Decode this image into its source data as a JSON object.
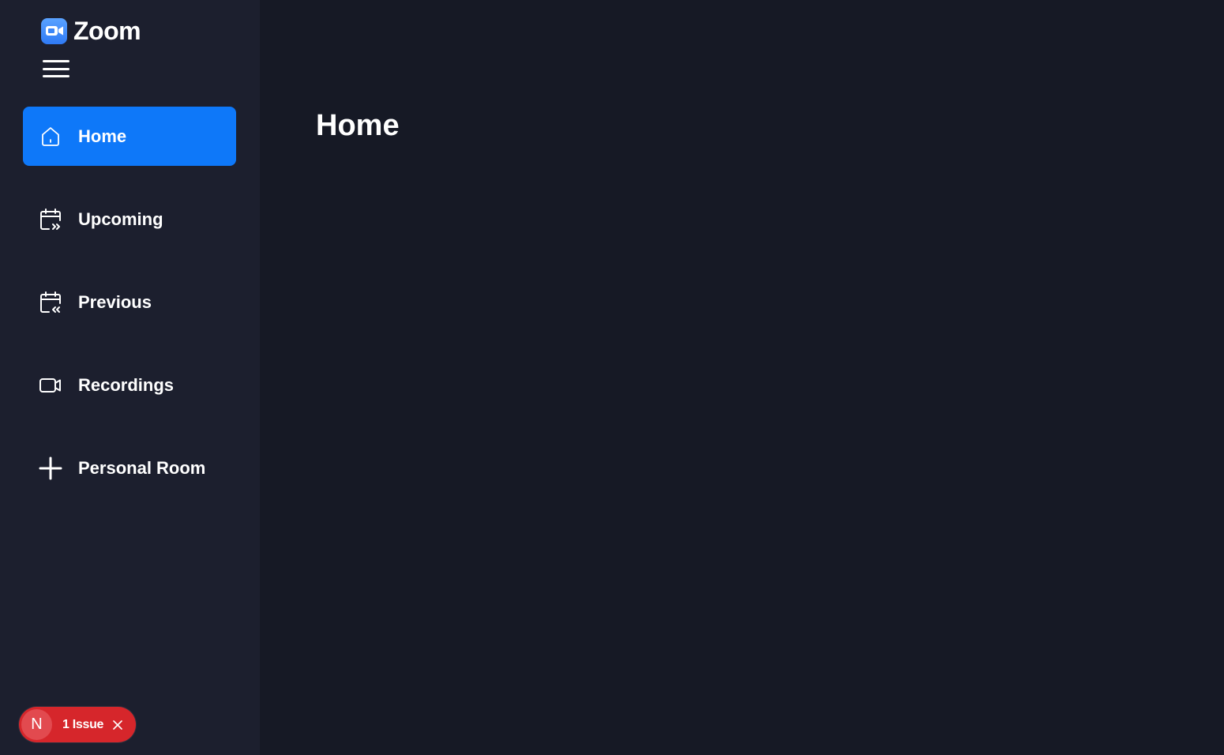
{
  "app": {
    "name": "Zoom",
    "logo_icon": "video-camera-icon",
    "brand_color": "#0e78f9"
  },
  "sidebar": {
    "menu_icon": "hamburger-menu-icon",
    "items": [
      {
        "label": "Home",
        "icon": "home-icon",
        "active": true
      },
      {
        "label": "Upcoming",
        "icon": "calendar-forward-icon",
        "active": false
      },
      {
        "label": "Previous",
        "icon": "calendar-back-icon",
        "active": false
      },
      {
        "label": "Recordings",
        "icon": "video-icon",
        "active": false
      },
      {
        "label": "Personal Room",
        "icon": "plus-icon",
        "active": false
      }
    ]
  },
  "main": {
    "title": "Home"
  },
  "issue_badge": {
    "avatar_letter": "N",
    "label": "1 Issue",
    "color": "#d6262b"
  }
}
